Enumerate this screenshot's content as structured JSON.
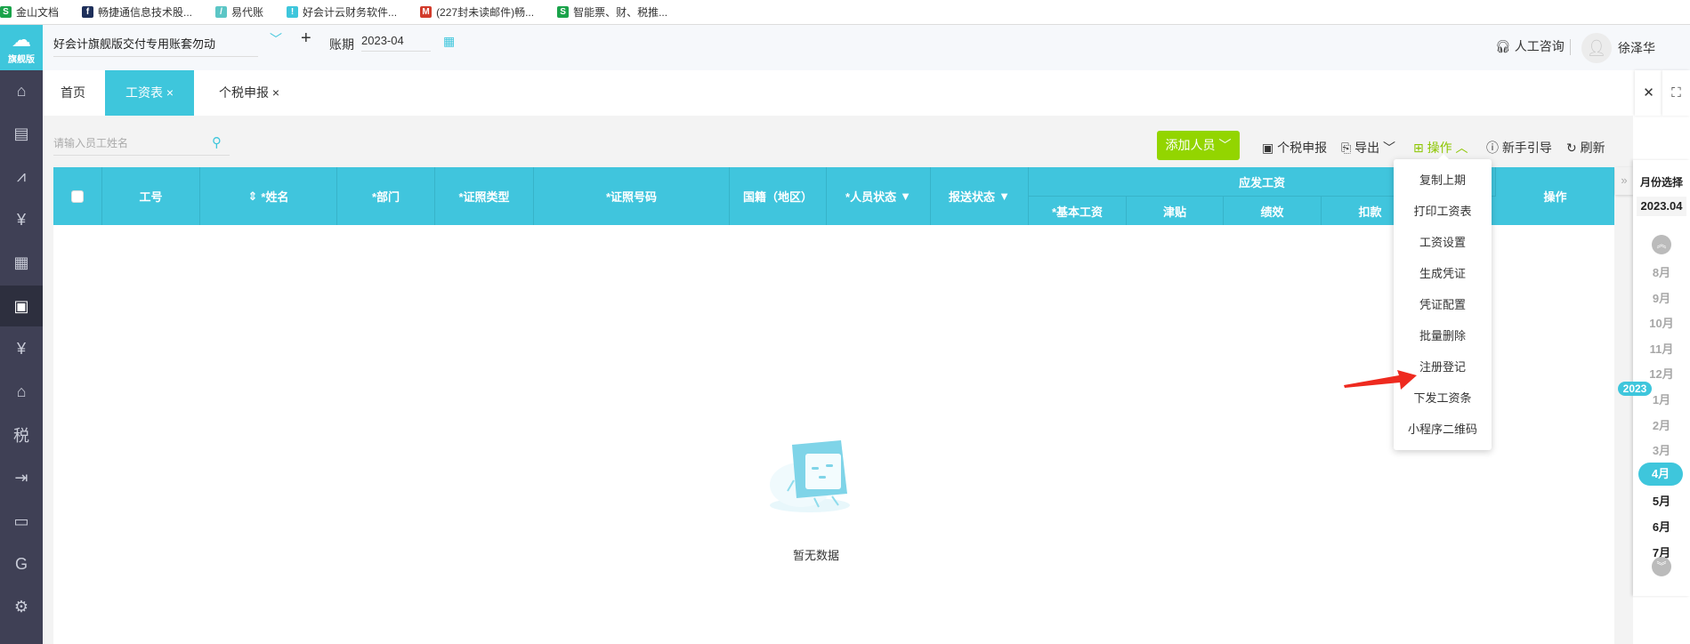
{
  "bookmarks": [
    {
      "label": "金山文档",
      "icon": "S",
      "color": "#1aa34a"
    },
    {
      "label": "畅捷通信息技术股...",
      "icon": "f",
      "color": "#1d2f5a"
    },
    {
      "label": "易代账",
      "icon": "/",
      "color": "#5cc6c6"
    },
    {
      "label": "好会计云财务软件...",
      "icon": "!",
      "color": "#3ec6dc"
    },
    {
      "label": "(227封未读邮件)畅...",
      "icon": "M",
      "color": "#d23b2b"
    },
    {
      "label": "智能票、财、税推...",
      "icon": "S",
      "color": "#1aa34a"
    }
  ],
  "sidebar": {
    "logo_label": "旗舰版",
    "items": [
      {
        "icon": "home-icon",
        "glyph": "⌂"
      },
      {
        "icon": "bill-icon",
        "glyph": "▤"
      },
      {
        "icon": "chart-icon",
        "glyph": "⩘"
      },
      {
        "icon": "money-bag-icon",
        "glyph": "¥"
      },
      {
        "icon": "building-icon",
        "glyph": "▦"
      },
      {
        "icon": "payroll-icon",
        "glyph": "▣",
        "active": true
      },
      {
        "icon": "cashier-icon",
        "glyph": "¥"
      },
      {
        "icon": "asset-icon",
        "glyph": "⌂"
      },
      {
        "icon": "tax-icon",
        "glyph": "税"
      },
      {
        "icon": "transfer-icon",
        "glyph": "⇥"
      },
      {
        "icon": "inbox-icon",
        "glyph": "▭"
      },
      {
        "icon": "c-logo-icon",
        "glyph": "G"
      },
      {
        "icon": "gear-icon",
        "glyph": "⚙"
      }
    ]
  },
  "header": {
    "company": "好会计旗舰版交付专用账套勿动",
    "period_label": "账期",
    "period": "2023-04",
    "consult": "人工咨询",
    "username": "徐泽华"
  },
  "tabs": [
    {
      "label": "首页"
    },
    {
      "label": "工资表",
      "active": true,
      "close": "×"
    },
    {
      "label": "个税申报",
      "close": "×"
    }
  ],
  "toolbar": {
    "search_placeholder": "请输入员工姓名",
    "add_person": "添加人员",
    "tax_report": "个税申报",
    "export": "导出",
    "operations": "操作",
    "guide": "新手引导",
    "refresh": "刷新"
  },
  "table": {
    "columns": [
      "工号",
      "*姓名",
      "*部门",
      "*证照类型",
      "*证照号码",
      "国籍（地区）",
      "*人员状态",
      "报送状态"
    ],
    "group_header": "应发工资",
    "group_columns": [
      "*基本工资",
      "津贴",
      "绩效",
      "扣款"
    ],
    "actions_header": "操作",
    "empty_text": "暂无数据"
  },
  "operations_menu": [
    "复制上期",
    "打印工资表",
    "工资设置",
    "生成凭证",
    "凭证配置",
    "批量删除",
    "注册登记",
    "下发工资条",
    "小程序二维码"
  ],
  "month_panel": {
    "title": "月份选择",
    "current": "2023.04",
    "year_badge": "2023",
    "months": [
      {
        "label": "8月",
        "state": "past"
      },
      {
        "label": "9月",
        "state": "past"
      },
      {
        "label": "10月",
        "state": "past"
      },
      {
        "label": "11月",
        "state": "past"
      },
      {
        "label": "12月",
        "state": "past"
      },
      {
        "label": "1月",
        "state": "past"
      },
      {
        "label": "2月",
        "state": "past"
      },
      {
        "label": "3月",
        "state": "past"
      },
      {
        "label": "4月",
        "state": "selected"
      },
      {
        "label": "5月",
        "state": "future"
      },
      {
        "label": "6月",
        "state": "future"
      },
      {
        "label": "7月",
        "state": "future"
      }
    ]
  },
  "colors": {
    "accent": "#3ec6dc",
    "add_button": "#93d500",
    "operations_active": "#8cc600",
    "sidebar": "#3f4055",
    "annotation_arrow": "#ee2a1f"
  }
}
